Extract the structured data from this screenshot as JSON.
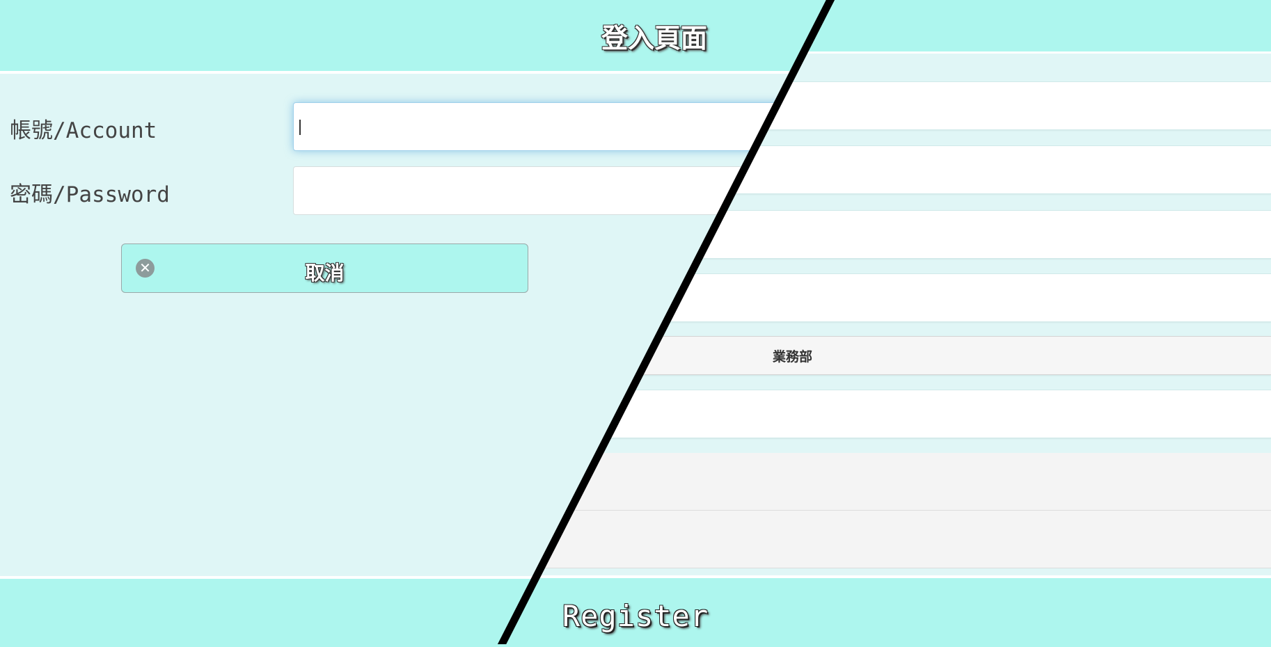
{
  "login": {
    "title": "登入頁面",
    "account_label": "帳號/Account",
    "account_value": "",
    "password_label": "密碼/Password",
    "password_value": "",
    "cancel_label": "取消",
    "cancel_icon": "close-circle-icon"
  },
  "register": {
    "title": "Register",
    "department_selected": "業務部"
  },
  "colors": {
    "header": "#adf6ee",
    "body": "#dff6f6",
    "divider": "#000000"
  }
}
